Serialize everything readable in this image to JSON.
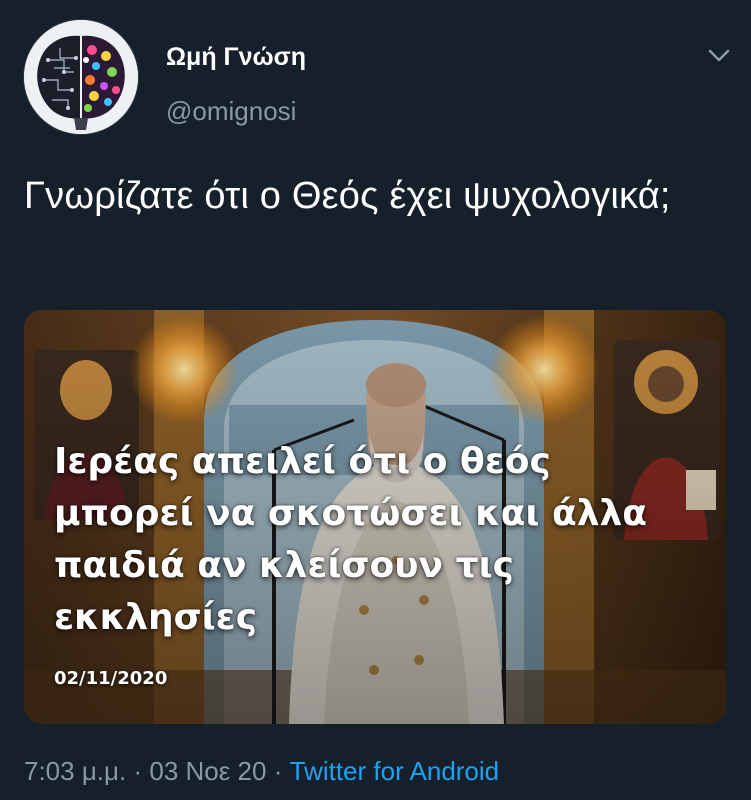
{
  "author": {
    "name": "Ωμή Γνώση",
    "handle": "@omignosi"
  },
  "tweet": {
    "text": "Γνωρίζατε ότι ο Θεός έχει ψυχολογικά;"
  },
  "media": {
    "caption": "Ιερέας απειλεί ότι ο θεός\nμπορεί να σκοτώσει και άλλα\nπαιδιά αν κλείσουν τις\nεκκλησίες",
    "date": "02/11/2020"
  },
  "meta": {
    "time": "7:03 μ.μ.",
    "separator1": " · ",
    "date": "03 Νοε 20",
    "separator2": " · ",
    "source": "Twitter for Android"
  },
  "icons": {
    "menu": "chevron-down-icon",
    "avatar": "brain-avatar"
  },
  "colors": {
    "background": "#15202b",
    "secondary_text": "#8899a6",
    "link": "#1da1f2"
  }
}
